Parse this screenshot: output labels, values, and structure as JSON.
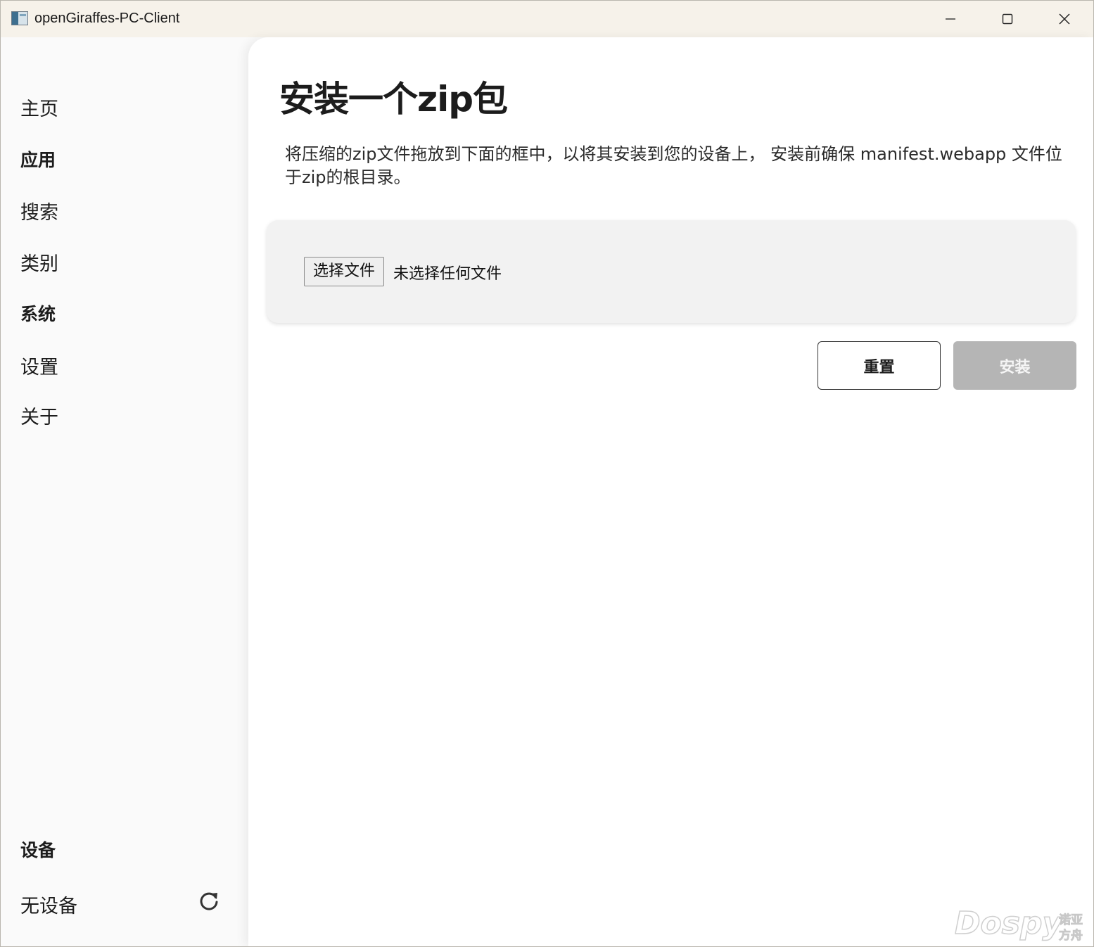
{
  "window": {
    "title": "openGiraffes-PC-Client",
    "controls": {
      "minimize_icon": "minimize-icon",
      "maximize_icon": "maximize-icon",
      "close_icon": "close-icon"
    }
  },
  "sidebar": {
    "items": [
      {
        "label": "主页",
        "type": "item"
      },
      {
        "label": "应用",
        "type": "header"
      },
      {
        "label": "搜索",
        "type": "item"
      },
      {
        "label": "类别",
        "type": "item"
      },
      {
        "label": "系统",
        "type": "header"
      },
      {
        "label": "设置",
        "type": "item"
      },
      {
        "label": "关于",
        "type": "item"
      }
    ],
    "devices_header": "设备",
    "device_status": "无设备",
    "refresh_icon": "refresh-icon"
  },
  "main": {
    "title": "安装一个zip包",
    "description": "将压缩的zip文件拖放到下面的框中，以将其安装到您的设备上， 安装前确保 manifest.webapp 文件位于zip的根目录。",
    "file_input": {
      "button_label": "选择文件",
      "status": "未选择任何文件"
    },
    "reset_label": "重置",
    "install_label": "安装"
  },
  "watermark": {
    "brand": "Dospy",
    "line1": "诺亚",
    "line2": "方舟"
  },
  "colors": {
    "titlebar_bg": "#f6f2ea",
    "sidebar_bg": "#fafafa",
    "panel_bg": "#ffffff",
    "dropzone_bg": "#f2f2f2",
    "install_disabled_bg": "#b5b5b5"
  }
}
